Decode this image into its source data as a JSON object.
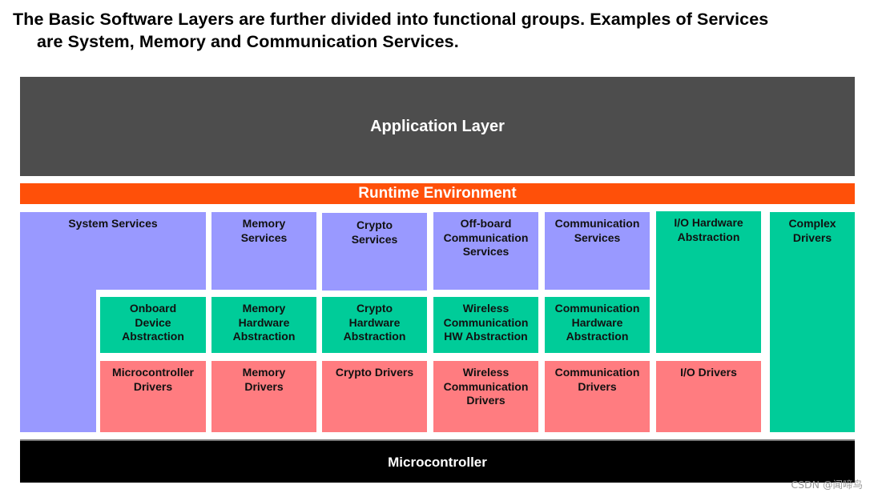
{
  "title": {
    "line1": "The Basic Software Layers are further divided into functional groups. Examples of Services",
    "line2": "are System, Memory and Communication Services."
  },
  "colors": {
    "application": "#4d4d4d",
    "runtime": "#ff5009",
    "services": "#9999ff",
    "abstraction": "#00cc99",
    "drivers": "#ff7c80",
    "microcontroller": "#000000"
  },
  "layers": {
    "application": "Application Layer",
    "runtime": "Runtime Environment",
    "microcontroller": "Microcontroller"
  },
  "services": {
    "system": [
      "System Services"
    ],
    "memory": [
      "Memory",
      "Services"
    ],
    "crypto": [
      "Crypto",
      "Services"
    ],
    "offboard": [
      "Off-board",
      "Communication",
      "Services"
    ],
    "communication": [
      "Communication",
      "Services"
    ]
  },
  "abstraction": {
    "onboard": [
      "Onboard",
      "Device",
      "Abstraction"
    ],
    "memory": [
      "Memory",
      "Hardware",
      "Abstraction"
    ],
    "crypto": [
      "Crypto",
      "Hardware",
      "Abstraction"
    ],
    "wireless": [
      "Wireless",
      "Communication",
      "HW Abstraction"
    ],
    "communication": [
      "Communication",
      "Hardware",
      "Abstraction"
    ],
    "io": [
      "I/O Hardware",
      "Abstraction"
    ]
  },
  "drivers": {
    "microcontroller": [
      "Microcontroller",
      "Drivers"
    ],
    "memory": [
      "Memory",
      "Drivers"
    ],
    "crypto": [
      "Crypto Drivers"
    ],
    "wireless": [
      "Wireless",
      "Communication",
      "Drivers"
    ],
    "communication": [
      "Communication",
      "Drivers"
    ],
    "io": [
      "I/O Drivers"
    ]
  },
  "complex": [
    "Complex",
    "Drivers"
  ],
  "watermark": "CSDN @闻啼鸟"
}
